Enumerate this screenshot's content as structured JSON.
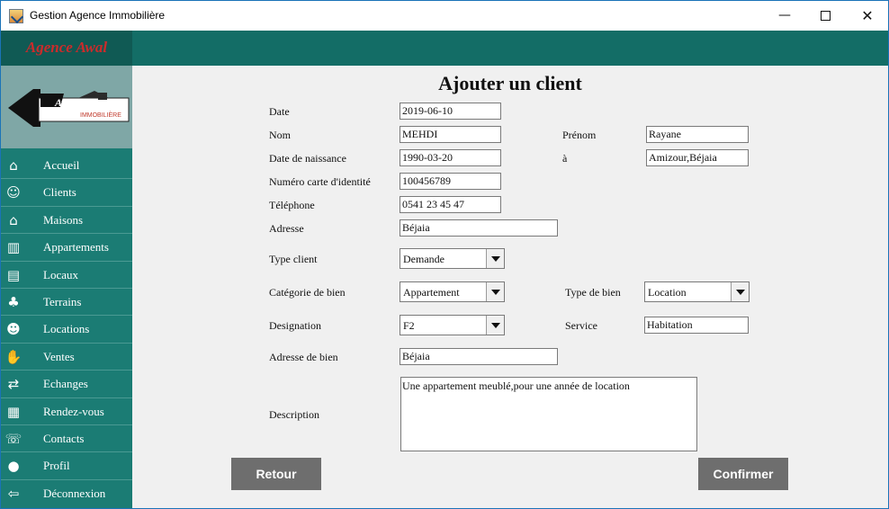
{
  "window": {
    "title": "Gestion Agence Immobilière",
    "controls": {
      "minimize": "—",
      "close": "✕"
    }
  },
  "brand": {
    "name": "Agence Awal",
    "logo_text": "Awal",
    "logo_subtext": "IMMOBILIÈRE"
  },
  "sidebar": {
    "items": [
      {
        "label": "Accueil",
        "icon": "home-icon"
      },
      {
        "label": "Clients",
        "icon": "clients-icon"
      },
      {
        "label": "Maisons",
        "icon": "house-icon"
      },
      {
        "label": "Appartements",
        "icon": "building-icon"
      },
      {
        "label": "Locaux",
        "icon": "shop-icon"
      },
      {
        "label": "Terrains",
        "icon": "land-icon"
      },
      {
        "label": "Locations",
        "icon": "rental-icon"
      },
      {
        "label": "Ventes",
        "icon": "sale-icon"
      },
      {
        "label": "Echanges",
        "icon": "exchange-icon"
      },
      {
        "label": "Rendez-vous",
        "icon": "calendar-icon"
      },
      {
        "label": "Contacts",
        "icon": "phone-icon"
      },
      {
        "label": "Profil",
        "icon": "user-icon"
      },
      {
        "label": "Déconnexion",
        "icon": "logout-icon"
      }
    ]
  },
  "form": {
    "title": "Ajouter un client",
    "labels": {
      "date": "Date",
      "nom": "Nom",
      "prenom": "Prénom",
      "date_naissance": "Date de naissance",
      "lieu": "à",
      "carte": "Numéro carte d'identité",
      "telephone": "Téléphone",
      "adresse": "Adresse",
      "type_client": "Type client",
      "categorie": "Catégorie de bien",
      "type_bien": "Type de bien",
      "designation": "Designation",
      "service": "Service",
      "adresse_bien": "Adresse de bien",
      "description": "Description"
    },
    "values": {
      "date": "2019-06-10",
      "nom": "MEHDI",
      "prenom": "Rayane",
      "date_naissance": "1990-03-20",
      "lieu": "Amizour,Béjaia",
      "carte": "100456789",
      "telephone": "0541 23 45 47",
      "adresse": "Béjaia",
      "type_client": "Demande",
      "categorie": "Appartement",
      "type_bien": "Location",
      "designation": "F2",
      "service": "Habitation",
      "adresse_bien": "Béjaia",
      "description": "Une appartement meublé,pour une année de location"
    },
    "buttons": {
      "retour": "Retour",
      "confirmer": "Confirmer"
    }
  },
  "colors": {
    "header": "#136d66",
    "sidebar": "#1b7c74",
    "brand_text": "#cc2b2b",
    "button": "#6e6e6e"
  }
}
